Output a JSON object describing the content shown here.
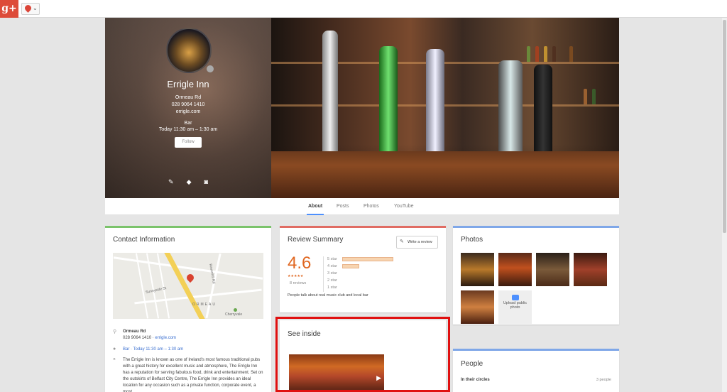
{
  "topbar": {
    "logo": "g+",
    "icons": [
      "page-switcher-icon",
      "chevron-down-icon"
    ]
  },
  "profile": {
    "name": "Errigle Inn",
    "address": "Ormeau Rd",
    "phone": "028 9064 1410",
    "website": "errigle.com",
    "category": "Bar",
    "hours": "Today 11:30 am – 1:30 am",
    "follow_label": "Follow",
    "action_icons": [
      "pencil-icon",
      "directions-icon",
      "camera-icon"
    ]
  },
  "tabs": [
    {
      "label": "About",
      "active": true
    },
    {
      "label": "Posts",
      "active": false
    },
    {
      "label": "Photos",
      "active": false
    },
    {
      "label": "YouTube",
      "active": false
    }
  ],
  "contact": {
    "title": "Contact Information",
    "map_labels": {
      "ormeau": "ORMEAU",
      "cherryvale": "Cherryvale",
      "ravenhill": "Ravenhill Rd",
      "sunnyside": "Sunnyside St"
    },
    "address_title": "Ormeau Rd",
    "phone_site": "028 9064 1410 · ",
    "site": "errigle.com",
    "hours_category": "Bar · Today 11:30 am – 1:30 am",
    "description": "The Errigle Inn is known as one of Ireland's most famous traditional pubs with a great history for excellent music and atmosphere, The Errigle Inn has a reputation for serving fabulous food, drink and entertainment.  Set on the outskirts of Belfast City Centre, The Errigle Inn provides an ideal location for any occasion such as a private function, corporate event, a most"
  },
  "review": {
    "title": "Review Summary",
    "write_label": "Write a review",
    "rating": "4.6",
    "stars": "★★★★★",
    "count": "8 reviews",
    "rows": [
      {
        "label": "5 star",
        "value": 6
      },
      {
        "label": "4 star",
        "value": 2
      },
      {
        "label": "3 star",
        "value": 0
      },
      {
        "label": "2 star",
        "value": 0
      },
      {
        "label": "1 star",
        "value": 0
      }
    ],
    "summary": "People talk about real music club and local bar"
  },
  "inside": {
    "title": "See inside"
  },
  "photos": {
    "title": "Photos",
    "upload_label": "Upload public photo"
  },
  "people": {
    "title": "People",
    "circles_label": "In their circles",
    "circles_count": "3 people"
  }
}
